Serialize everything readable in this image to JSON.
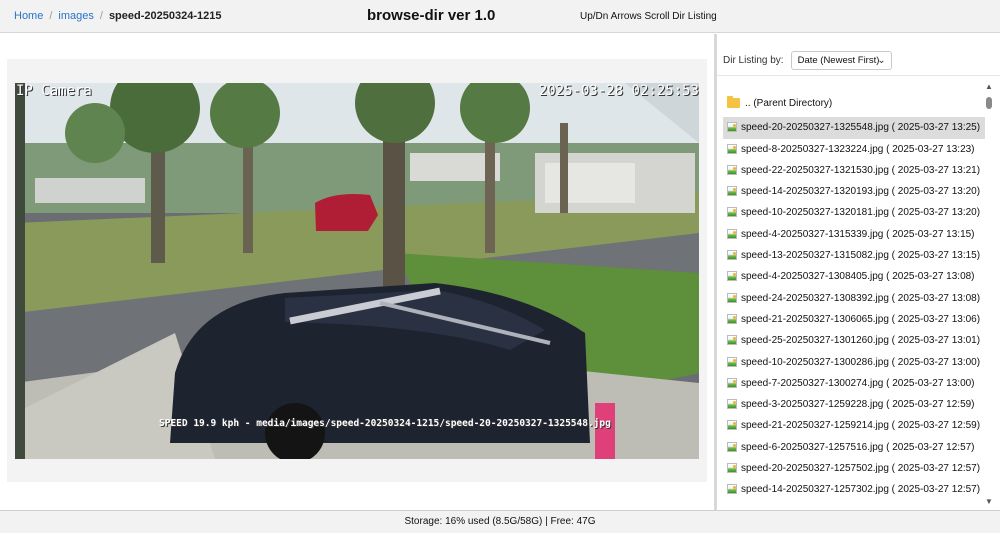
{
  "breadcrumb": {
    "home": "Home",
    "separator": "/",
    "images": "images",
    "current": "speed-20250324-1215"
  },
  "header": {
    "title": "browse-dir ver 1.0",
    "hint": "Up/Dn Arrows Scroll Dir Listing"
  },
  "viewer": {
    "camera_label": "IP Camera",
    "timestamp": "2025-03-28 02:25:53",
    "caption": "SPEED 19.9 kph - media/images/speed-20250324-1215/speed-20-20250327-1325548.jpg"
  },
  "sidebar": {
    "sort_label": "Dir Listing by:",
    "sort_value": "Date (Newest First)",
    "parent_dir": ".. (Parent Directory)",
    "files": [
      {
        "label": "speed-20-20250327-1325548.jpg ( 2025-03-27 13:25)",
        "selected": true
      },
      {
        "label": "speed-8-20250327-1323224.jpg ( 2025-03-27 13:23)"
      },
      {
        "label": "speed-22-20250327-1321530.jpg ( 2025-03-27 13:21)"
      },
      {
        "label": "speed-14-20250327-1320193.jpg ( 2025-03-27 13:20)"
      },
      {
        "label": "speed-10-20250327-1320181.jpg ( 2025-03-27 13:20)"
      },
      {
        "label": "speed-4-20250327-1315339.jpg ( 2025-03-27 13:15)"
      },
      {
        "label": "speed-13-20250327-1315082.jpg ( 2025-03-27 13:15)"
      },
      {
        "label": "speed-4-20250327-1308405.jpg ( 2025-03-27 13:08)"
      },
      {
        "label": "speed-24-20250327-1308392.jpg ( 2025-03-27 13:08)"
      },
      {
        "label": "speed-21-20250327-1306065.jpg ( 2025-03-27 13:06)"
      },
      {
        "label": "speed-25-20250327-1301260.jpg ( 2025-03-27 13:01)"
      },
      {
        "label": "speed-10-20250327-1300286.jpg ( 2025-03-27 13:00)"
      },
      {
        "label": "speed-7-20250327-1300274.jpg ( 2025-03-27 13:00)"
      },
      {
        "label": "speed-3-20250327-1259228.jpg ( 2025-03-27 12:59)"
      },
      {
        "label": "speed-21-20250327-1259214.jpg ( 2025-03-27 12:59)"
      },
      {
        "label": "speed-6-20250327-1257516.jpg ( 2025-03-27 12:57)"
      },
      {
        "label": "speed-20-20250327-1257502.jpg ( 2025-03-27 12:57)"
      },
      {
        "label": "speed-14-20250327-1257302.jpg ( 2025-03-27 12:57)"
      }
    ]
  },
  "footer": {
    "storage": "Storage: 16% used (8.5G/58G) | Free: 47G"
  },
  "colors": {
    "link": "#2a73c9",
    "selected_row": "#dcdcdc",
    "folder": "#f5c242",
    "header_bg": "#f2f2f2"
  },
  "icons": {
    "folder": "folder-icon",
    "file": "image-file-icon",
    "select": "chevron-down-icon"
  }
}
